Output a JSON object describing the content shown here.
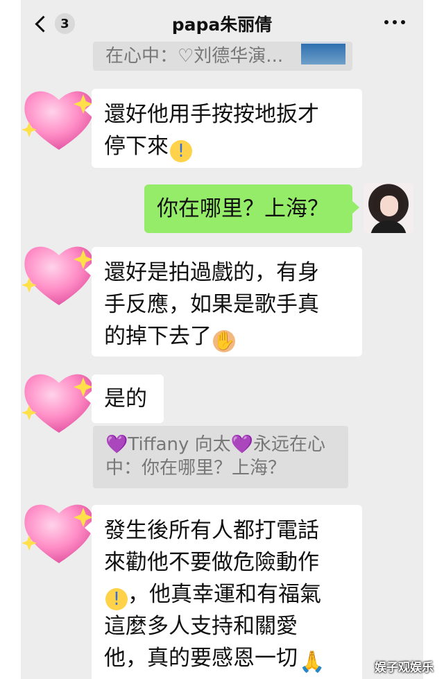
{
  "header": {
    "unread_count": "3",
    "title": "papa朱丽倩"
  },
  "quotes": {
    "top_quote": "在心中：♡刘德华演...",
    "middle_quote_line1": "💜Tiffany 向太💜永远在心",
    "middle_quote_line2": "中：你在哪里？上海？"
  },
  "messages": {
    "m1_line1": "還好他用手按按地扳才",
    "m1_line2": "停下來",
    "m2": "你在哪里？上海？",
    "m3_line1": "還好是拍過戲的，有身",
    "m3_line2": "手反應，如果是歌手真",
    "m3_line3": "的掉下去了",
    "m4": "是的",
    "m5_line1": "發生後所有人都打電話",
    "m5_line2": "來勸他不要做危險動作",
    "m5_line3": "，他真幸運和有福氣",
    "m5_line4": "這麼多人支持和關愛",
    "m5_line5": "他，真的要感恩一切"
  },
  "icons": {
    "back": "chevron-left-icon",
    "more": "more-dots-icon",
    "sweat": "anxious-face-sweat-emoji",
    "facepalm": "person-facepalming-emoji",
    "pray": "folded-hands-emoji",
    "heart_avatar": "sparkling-heart-avatar"
  },
  "colors": {
    "chat_bg": "#ededed",
    "my_bubble": "#95ec69",
    "their_bubble": "#ffffff",
    "quote_bg": "#dedede"
  },
  "watermark": "娱子观娱乐"
}
